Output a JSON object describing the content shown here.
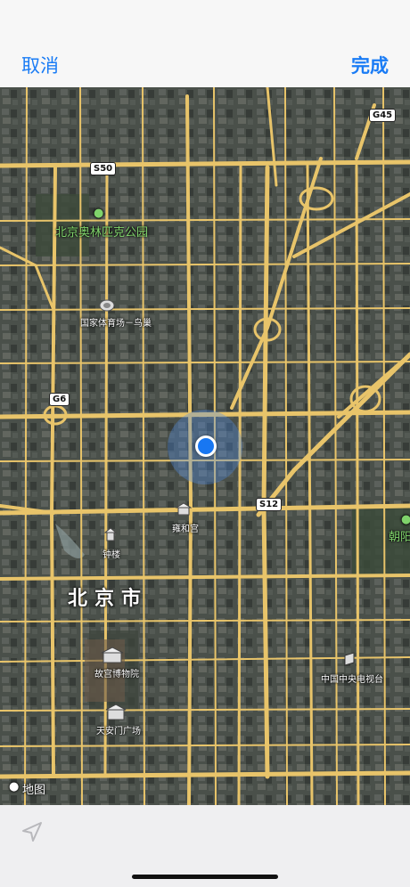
{
  "nav": {
    "cancel_label": "取消",
    "done_label": "完成"
  },
  "map": {
    "type": "satellite",
    "city_label": "北京市",
    "attribution": "地图",
    "shields": [
      "S50",
      "G45",
      "G6",
      "S12"
    ],
    "places": {
      "olympic_park": "北京奥林匹克公园",
      "stadium": "国家体育场－鸟巢",
      "yonghe": "雍和宫",
      "bell_tower": "钟楼",
      "palace_museum": "故宫博物院",
      "tiananmen": "天安门广场",
      "cctv": "中国中央电视台",
      "chaoyang": "朝阳"
    }
  },
  "colors": {
    "accent": "#1a7cf5",
    "road": "#e8c46a",
    "location": "#1877f2"
  }
}
